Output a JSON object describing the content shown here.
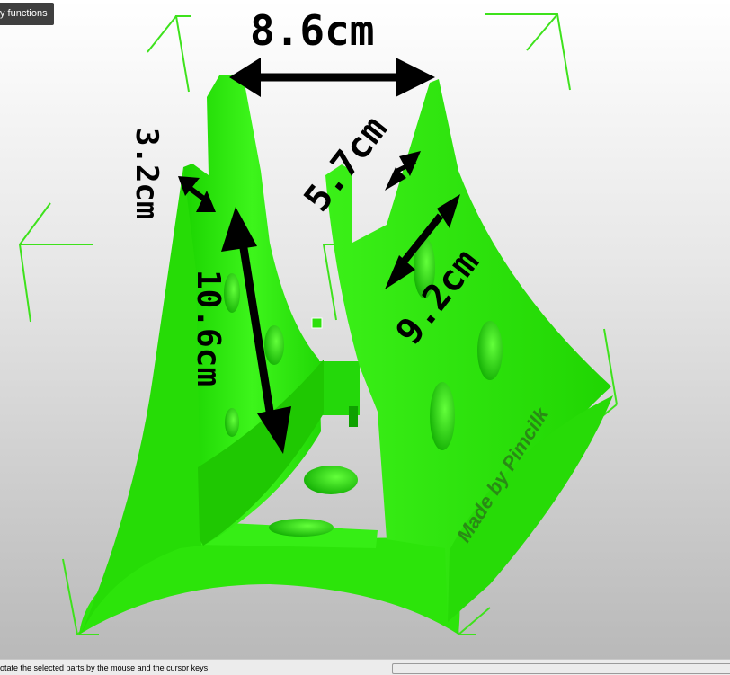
{
  "menu": {
    "label": "y functions"
  },
  "dimensions": {
    "width": "8.6cm",
    "left_top": "3.2cm",
    "left_long": "10.6cm",
    "right_top": "5.7cm",
    "right_long": "9.2cm"
  },
  "model": {
    "engraving": "Made by Pimcilk",
    "color": "#2be000"
  },
  "status": {
    "text": "otate the selected parts by the mouse and the cursor keys",
    "progress": 0
  }
}
